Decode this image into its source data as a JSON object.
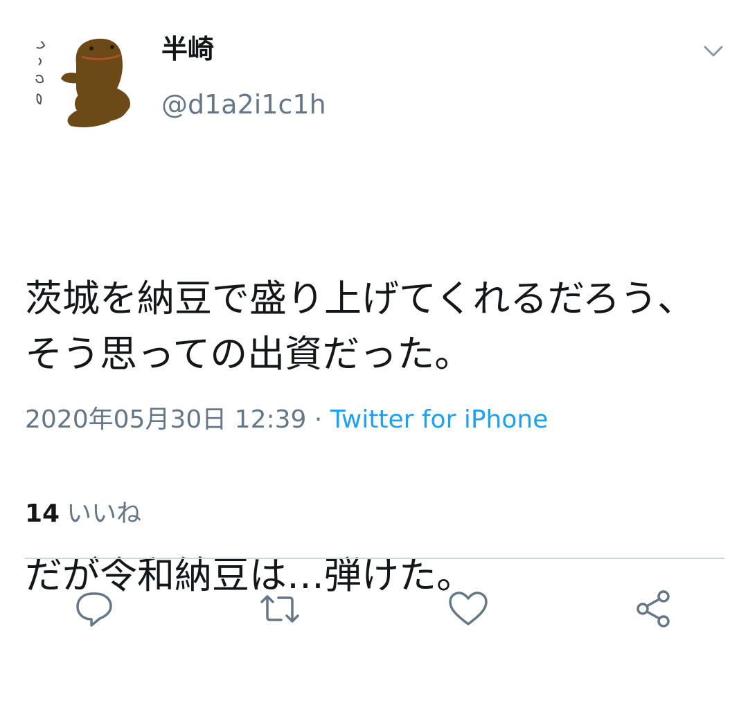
{
  "author": {
    "display_name": "半崎",
    "handle": "@d1a2i1c1h",
    "avatar_icon": "salamander-avatar-icon",
    "avatar_text": "ぶーさん"
  },
  "menu": {
    "caret_icon": "chevron-down-icon"
  },
  "tweet": {
    "paragraph_1": "茨城を納豆で盛り上げてくれるだろう、そう思っての出資だった。",
    "paragraph_2": "だが令和納豆は…弾けた。",
    "timestamp": "2020年05月30日 12:39",
    "separator": " · ",
    "source": "Twitter for iPhone"
  },
  "stats": {
    "likes_count": "14",
    "likes_label": "いいね"
  },
  "actions": [
    {
      "name": "reply",
      "icon": "reply-icon"
    },
    {
      "name": "retweet",
      "icon": "retweet-icon"
    },
    {
      "name": "like",
      "icon": "heart-icon"
    },
    {
      "name": "share",
      "icon": "share-icon"
    }
  ],
  "colors": {
    "text": "#14171a",
    "secondary": "#657786",
    "link": "#1da1f2",
    "divider": "#ccd6dd"
  }
}
